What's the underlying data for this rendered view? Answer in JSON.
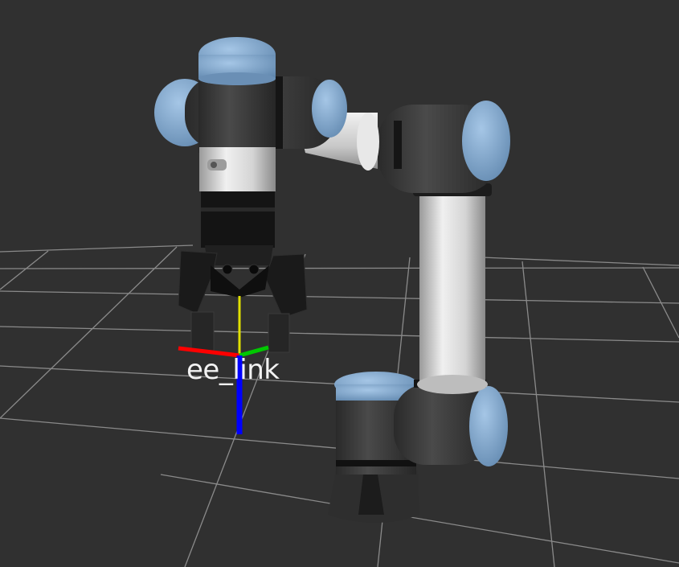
{
  "scene": {
    "background_color": "#303030",
    "grid_color": "#a0a0a0",
    "robot": {
      "joint_cap_color": "#7fa7cf",
      "body_color": "#3a3a3a",
      "tube_color": "#d6d6d6",
      "gripper_color": "#1a1a1a"
    },
    "frame": {
      "label": "ee_link",
      "axis_colors": {
        "x": "#ff0000",
        "y": "#00c800",
        "z": "#0000ff",
        "approach": "#e0e000"
      }
    }
  }
}
